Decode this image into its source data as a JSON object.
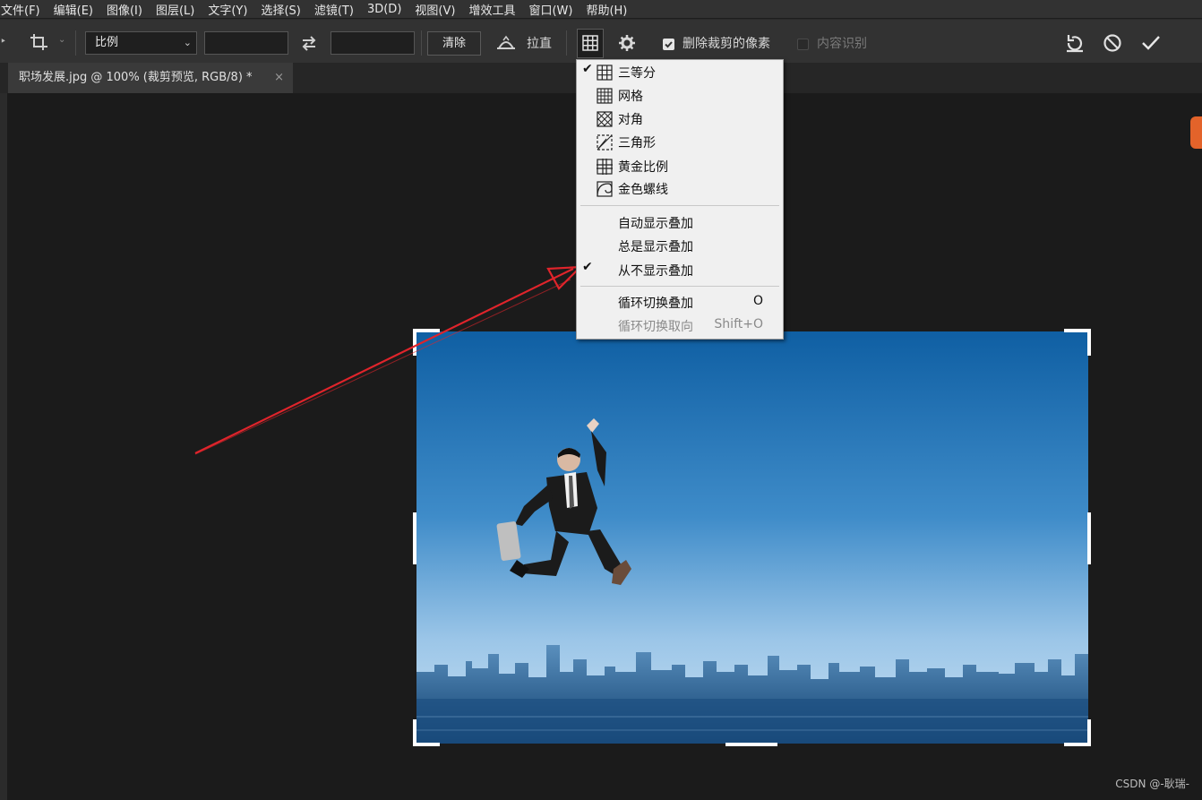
{
  "menubar": {
    "items": [
      "文件(F)",
      "编辑(E)",
      "图像(I)",
      "图层(L)",
      "文字(Y)",
      "选择(S)",
      "滤镜(T)",
      "3D(D)",
      "视图(V)",
      "增效工具",
      "窗口(W)",
      "帮助(H)"
    ]
  },
  "options": {
    "ratio_label": "比例",
    "width_value": "",
    "height_value": "",
    "clear_label": "清除",
    "straighten_label": "拉直",
    "delete_pixels_label": "删除裁剪的像素",
    "delete_pixels_checked": true,
    "content_aware_label": "内容识别",
    "content_aware_checked": false
  },
  "tab": {
    "title": "职场发展.jpg @ 100% (裁剪预览, RGB/8) *",
    "close": "×"
  },
  "overlay_menu": {
    "overlays": [
      {
        "label": "三等分",
        "icon": "rule-of-thirds-icon",
        "checked": true
      },
      {
        "label": "网格",
        "icon": "grid-icon",
        "checked": false
      },
      {
        "label": "对角",
        "icon": "diagonal-icon",
        "checked": false
      },
      {
        "label": "三角形",
        "icon": "triangle-icon",
        "checked": false
      },
      {
        "label": "黄金比例",
        "icon": "golden-ratio-icon",
        "checked": false
      },
      {
        "label": "金色螺线",
        "icon": "golden-spiral-icon",
        "checked": false
      }
    ],
    "display_modes": [
      {
        "label": "自动显示叠加",
        "checked": false
      },
      {
        "label": "总是显示叠加",
        "checked": false
      },
      {
        "label": "从不显示叠加",
        "checked": true
      }
    ],
    "cycle": [
      {
        "label": "循环切换叠加",
        "shortcut": "O",
        "disabled": false
      },
      {
        "label": "循环切换取向",
        "shortcut": "Shift+O",
        "disabled": true
      }
    ],
    "check_mark": "✔"
  },
  "watermark": "CSDN @-耿瑞-",
  "colors": {
    "ui_dark": "#323232",
    "canvas": "#1b1b1b",
    "arrow": "#e0242b",
    "sky_top": "#0f5fa3",
    "sky_bottom": "#b8d6ee"
  }
}
